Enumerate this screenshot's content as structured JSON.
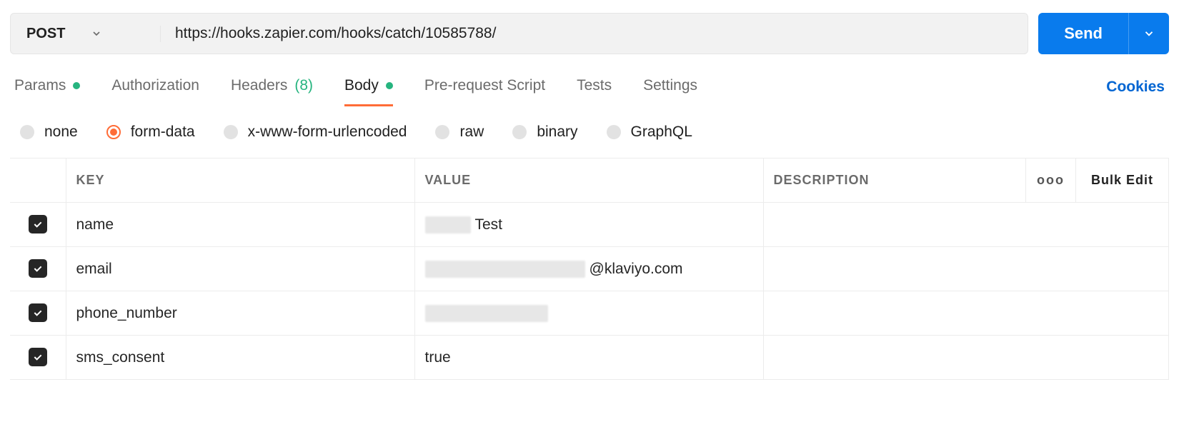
{
  "request": {
    "method": "POST",
    "url": "https://hooks.zapier.com/hooks/catch/10585788/",
    "send_label": "Send"
  },
  "tabs": {
    "params": "Params",
    "authorization": "Authorization",
    "headers": "Headers",
    "headers_count": "(8)",
    "body": "Body",
    "pre_request": "Pre-request Script",
    "tests": "Tests",
    "settings": "Settings",
    "cookies": "Cookies"
  },
  "body_types": {
    "none": "none",
    "form_data": "form-data",
    "x_www": "x-www-form-urlencoded",
    "raw": "raw",
    "binary": "binary",
    "graphql": "GraphQL"
  },
  "table": {
    "headers": {
      "key": "KEY",
      "value": "VALUE",
      "description": "DESCRIPTION",
      "bulk_edit": "Bulk Edit",
      "more": "ooo"
    },
    "rows": [
      {
        "key": "name",
        "value_suffix": "Test",
        "redacted_width": 64
      },
      {
        "key": "email",
        "value_suffix": "@klaviyo.com",
        "redacted_width": 224
      },
      {
        "key": "phone_number",
        "value_suffix": "",
        "redacted_width": 172
      },
      {
        "key": "sms_consent",
        "value_suffix": "true",
        "redacted_width": 0
      }
    ]
  }
}
